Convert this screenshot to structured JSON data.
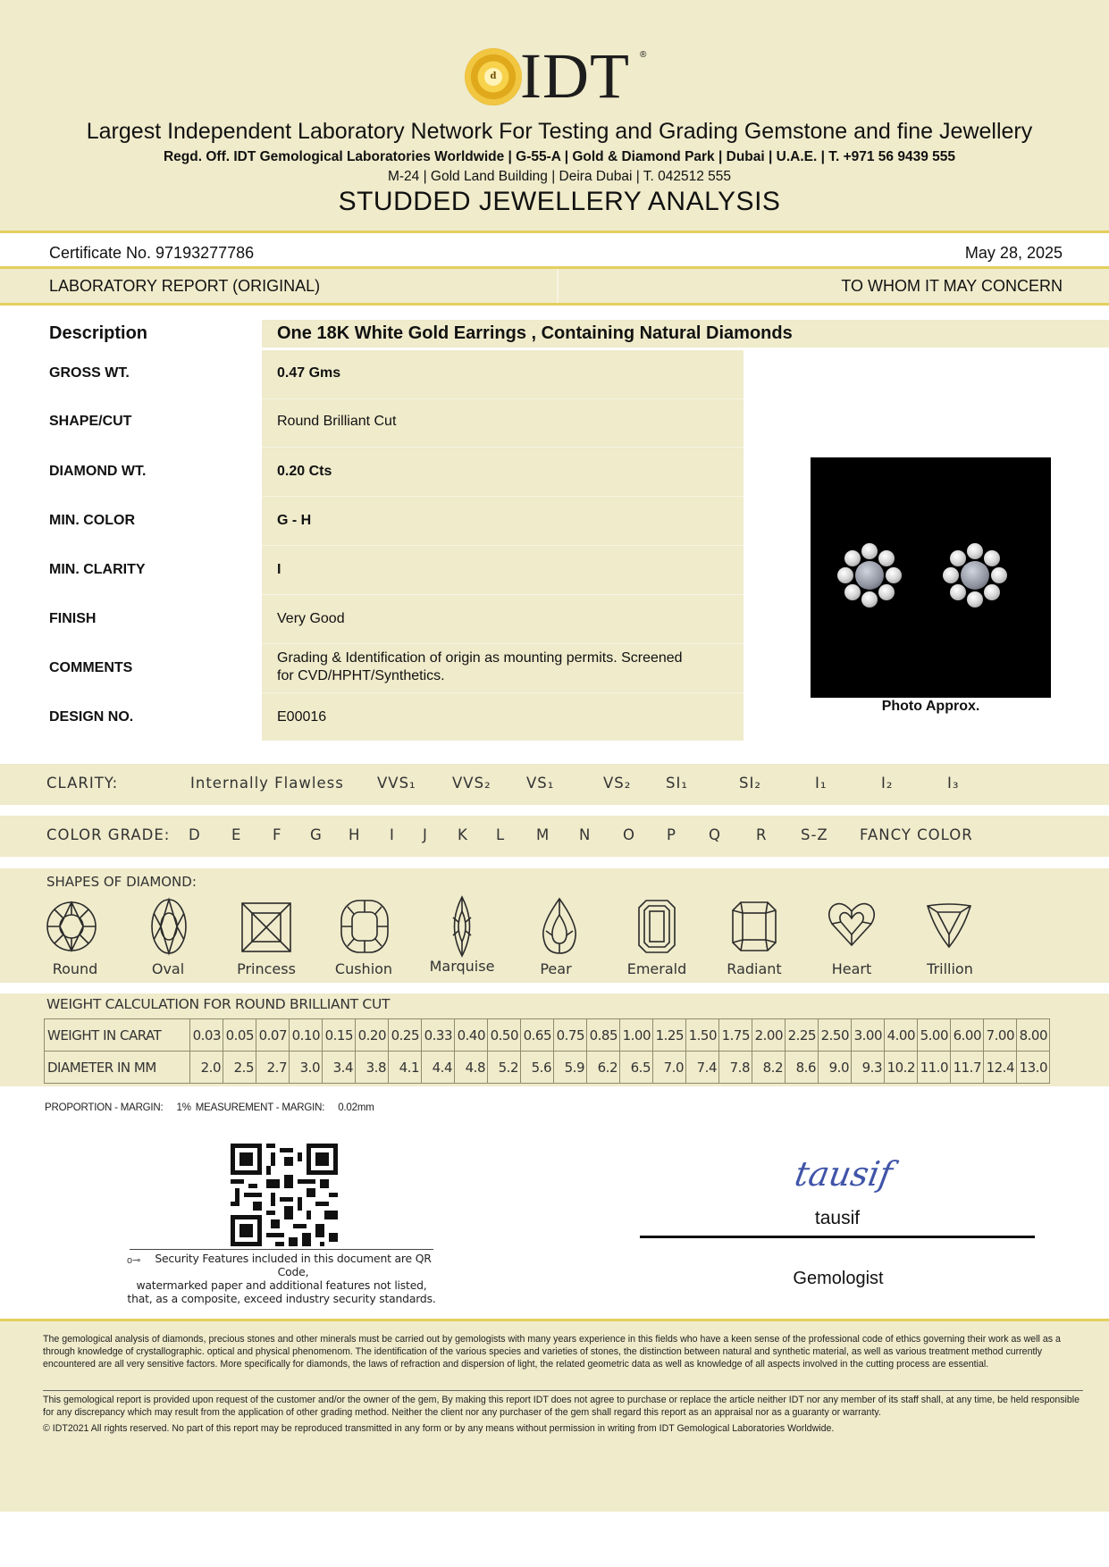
{
  "header": {
    "brand": "IDT",
    "seal_letter": "d",
    "tagline": "Largest Independent Laboratory Network For Testing and Grading Gemstone and fine Jewellery",
    "regd_office": "Regd. Off. IDT Gemological Laboratories Worldwide | G-55-A | Gold & Diamond Park | Dubai | U.A.E. | T. +971 56 9439 555",
    "branch_address": "M-24 | Gold Land Building | Deira Dubai | T. 042512 555",
    "document_title": "STUDDED JEWELLERY ANALYSIS"
  },
  "certificate": {
    "number": "Certificate No. 97193277786",
    "date": "May 28, 2025",
    "report_type": "LABORATORY REPORT (ORIGINAL)",
    "addressee": "TO WHOM IT MAY CONCERN"
  },
  "description": {
    "label": "Description",
    "value": "One 18K White Gold Earrings , Containing Natural Diamonds",
    "rows": [
      {
        "label": "GROSS WT.",
        "value": "0.47 Gms"
      },
      {
        "label": "SHAPE/CUT",
        "value": "Round Brilliant Cut"
      },
      {
        "label": "DIAMOND WT.",
        "value": "0.20 Cts"
      },
      {
        "label": "MIN. COLOR",
        "value": "G - H"
      },
      {
        "label": "MIN. CLARITY",
        "value": "I"
      },
      {
        "label": "FINISH",
        "value": "Very Good"
      },
      {
        "label": "COMMENTS",
        "value_line1": "Grading & Identification of origin as mounting permits. Screened",
        "value_line2": "for CVD/HPHT/Synthetics."
      },
      {
        "label": "DESIGN NO.",
        "value": "E00016"
      }
    ],
    "photo_caption": "Photo Approx."
  },
  "clarity_scale": {
    "label": "CLARITY:",
    "grades": [
      "Internally Flawless",
      "VVS₁",
      "VVS₂",
      "VS₁",
      "VS₂",
      "SI₁",
      "SI₂",
      "I₁",
      "I₂",
      "I₃"
    ]
  },
  "color_scale": {
    "label": "COLOR GRADE:",
    "grades": [
      "D",
      "E",
      "F",
      "G",
      "H",
      "I",
      "J",
      "K",
      "L",
      "M",
      "N",
      "O",
      "P",
      "Q",
      "R",
      "S-Z",
      "FANCY COLOR"
    ]
  },
  "shapes": {
    "title": "SHAPES OF DIAMOND:",
    "items": [
      "Round",
      "Oval",
      "Princess",
      "Cushion",
      "Marquise",
      "Pear",
      "Emerald",
      "Radiant",
      "Heart",
      "Trillion"
    ]
  },
  "weight_calc": {
    "title": "WEIGHT CALCULATION FOR  ROUND BRILLIANT CUT",
    "row1_label": "WEIGHT IN CARAT",
    "row2_label": "DIAMETER IN MM",
    "carats": [
      "0.03",
      "0.05",
      "0.07",
      "0.10",
      "0.15",
      "0.20",
      "0.25",
      "0.33",
      "0.40",
      "0.50",
      "0.65",
      "0.75",
      "0.85",
      "1.00",
      "1.25",
      "1.50",
      "1.75",
      "2.00",
      "2.25",
      "2.50",
      "3.00",
      "4.00",
      "5.00",
      "6.00",
      "7.00",
      "8.00"
    ],
    "diameters": [
      "2.0",
      "2.5",
      "2.7",
      "3.0",
      "3.4",
      "3.8",
      "4.1",
      "4.4",
      "4.8",
      "5.2",
      "5.6",
      "5.9",
      "6.2",
      "6.5",
      "7.0",
      "7.4",
      "7.8",
      "8.2",
      "8.6",
      "9.0",
      "9.3",
      "10.2",
      "11.0",
      "11.7",
      "12.4",
      "13.0"
    ]
  },
  "proportion": {
    "margin_label": "PROPORTION - MARGIN:",
    "margin_value": "1%",
    "measurement_label": "MEASUREMENT - MARGIN:",
    "measurement_value": "0.02mm"
  },
  "security": {
    "line1": "Security Features included in this document are QR Code,",
    "line2": "watermarked paper and additional features not listed,",
    "line3": "that, as a composite, exceed industry security standards."
  },
  "signature": {
    "script": "tausif",
    "name": "tausif",
    "title": "Gemologist"
  },
  "disclaimer": {
    "p1": "The gemological analysis of diamonds, precious stones and other minerals must be carried out by gemologists with many years experience in this fields who have a keen sense of the professional code of ethics governing their work as well as a through knowledge  of crystallographic. optical and physical phenomenom. The identification of the various species and varieties of stones, the distinction between natural and synthetic material, as well as various treatment method currently encountered are all very sensitive factors. More specifically for diamonds, the laws of refraction and dispersion of light, the related geometric data as well as knowledge of all aspects involved in the cutting process are essential.",
    "p2": "This gemological report is provided upon request of the customer and/or the owner of the gem, By making this report IDT does not agree to purchase or replace the article neither IDT nor any member of its staff shall, at any time, be held responsible for any discrepancy which may result from the application of other grading method. Neither the client nor any purchaser of the gem shall regard this report as an appraisal nor as a guaranty or warranty.",
    "p3": "© IDT2021 All rights reserved. No part of this report may be reproduced transmitted in any form or by any means without permission in writing from IDT Gemological Laboratories Worldwide."
  },
  "colors": {
    "band": "#efebcb",
    "gold_rule": "#e4cf5d"
  }
}
